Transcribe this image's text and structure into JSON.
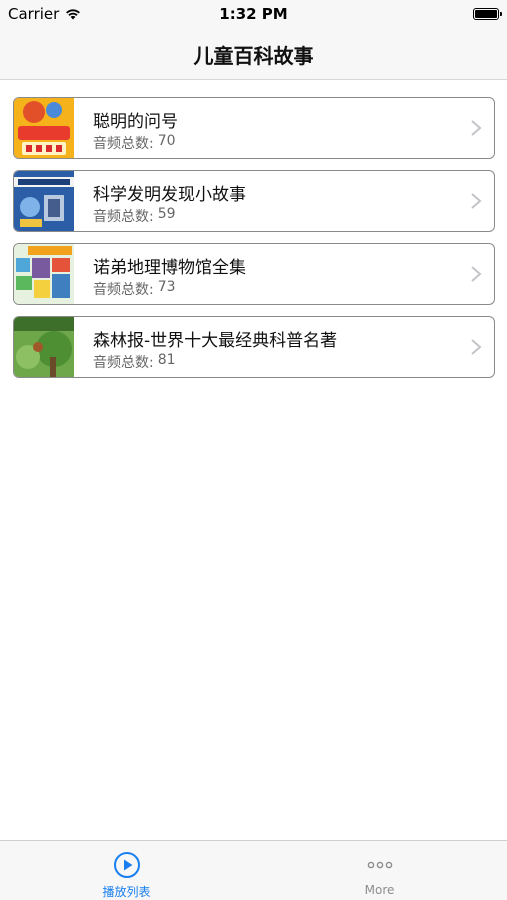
{
  "status_bar": {
    "carrier": "Carrier",
    "time": "1:32 PM",
    "battery_level": 1.0
  },
  "nav_bar": {
    "title": "儿童百科故事"
  },
  "list": {
    "items": [
      {
        "title": "聪明的问号",
        "subtitle_label": "音频总数:",
        "subtitle_value": "70",
        "thumb_icon": "book-cover-icon"
      },
      {
        "title": "科学发明发现小故事",
        "subtitle_label": "音频总数:",
        "subtitle_value": "59",
        "thumb_icon": "book-cover-icon"
      },
      {
        "title": "诺弟地理博物馆全集",
        "subtitle_label": "音频总数:",
        "subtitle_value": "73",
        "thumb_icon": "book-cover-icon"
      },
      {
        "title": "森林报-世界十大最经典科普名著",
        "subtitle_label": "音频总数:",
        "subtitle_value": "81",
        "thumb_icon": "book-cover-icon"
      }
    ]
  },
  "tab_bar": {
    "tabs": [
      {
        "label": "播放列表",
        "icon": "play-circle-icon",
        "active": true
      },
      {
        "label": "More",
        "icon": "more-dots-icon",
        "active": false
      }
    ]
  },
  "colors": {
    "accent": "#1a7ff0",
    "bar_background": "#f7f7f7",
    "subtitle_gray": "#666666"
  }
}
